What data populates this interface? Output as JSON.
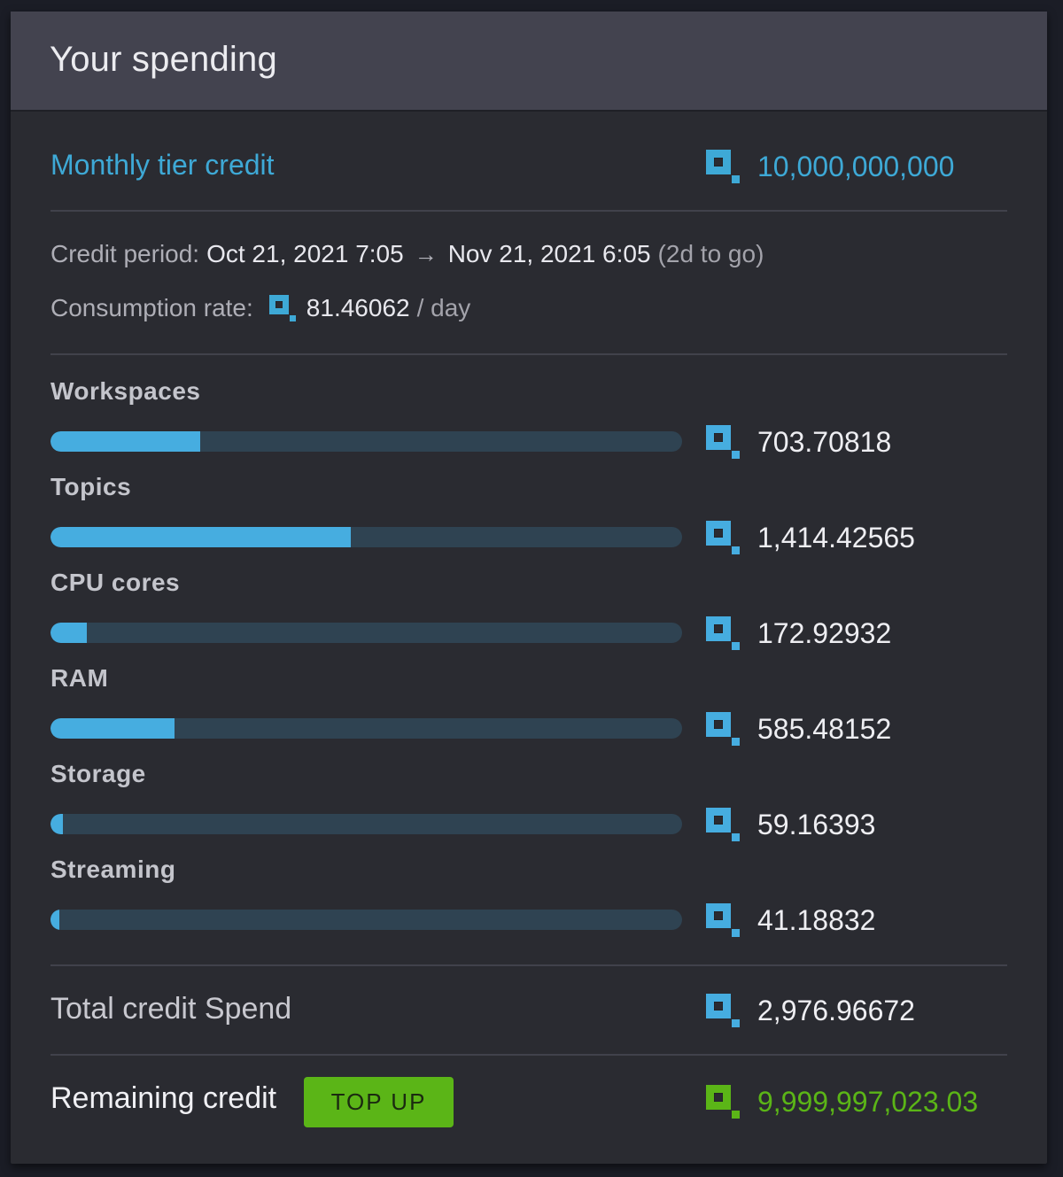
{
  "colors": {
    "accent_blue": "#3ea9d6",
    "bar_fill": "#46ade0",
    "bar_track": "#2f4352",
    "positive_green": "#5bb517",
    "header_bg": "#43434f",
    "card_bg": "#2a2b31"
  },
  "header": {
    "title": "Your spending"
  },
  "monthly": {
    "label": "Monthly tier credit",
    "icon": "credit-icon",
    "value": "10,000,000,000"
  },
  "period": {
    "label": "Credit period:",
    "start": "Oct 21, 2021 7:05",
    "arrow": "→",
    "end": "Nov 21, 2021 6:05",
    "remaining": "(2d to go)"
  },
  "consumption": {
    "label": "Consumption rate:",
    "icon": "credit-icon",
    "value": "81.46062",
    "unit": "/ day"
  },
  "categories": [
    {
      "label": "Workspaces",
      "value": "703.70818",
      "share": 0.2364
    },
    {
      "label": "Topics",
      "value": "1,414.42565",
      "share": 0.4751
    },
    {
      "label": "CPU cores",
      "value": "172.92932",
      "share": 0.0581
    },
    {
      "label": "RAM",
      "value": "585.48152",
      "share": 0.1967
    },
    {
      "label": "Storage",
      "value": "59.16393",
      "share": 0.0199
    },
    {
      "label": "Streaming",
      "value": "41.18832",
      "share": 0.0138
    }
  ],
  "total": {
    "label": "Total credit Spend",
    "icon": "credit-icon",
    "value": "2,976.96672"
  },
  "remaining": {
    "label": "Remaining credit",
    "button_label": "TOP UP",
    "icon": "credit-icon",
    "value": "9,999,997,023.03"
  }
}
